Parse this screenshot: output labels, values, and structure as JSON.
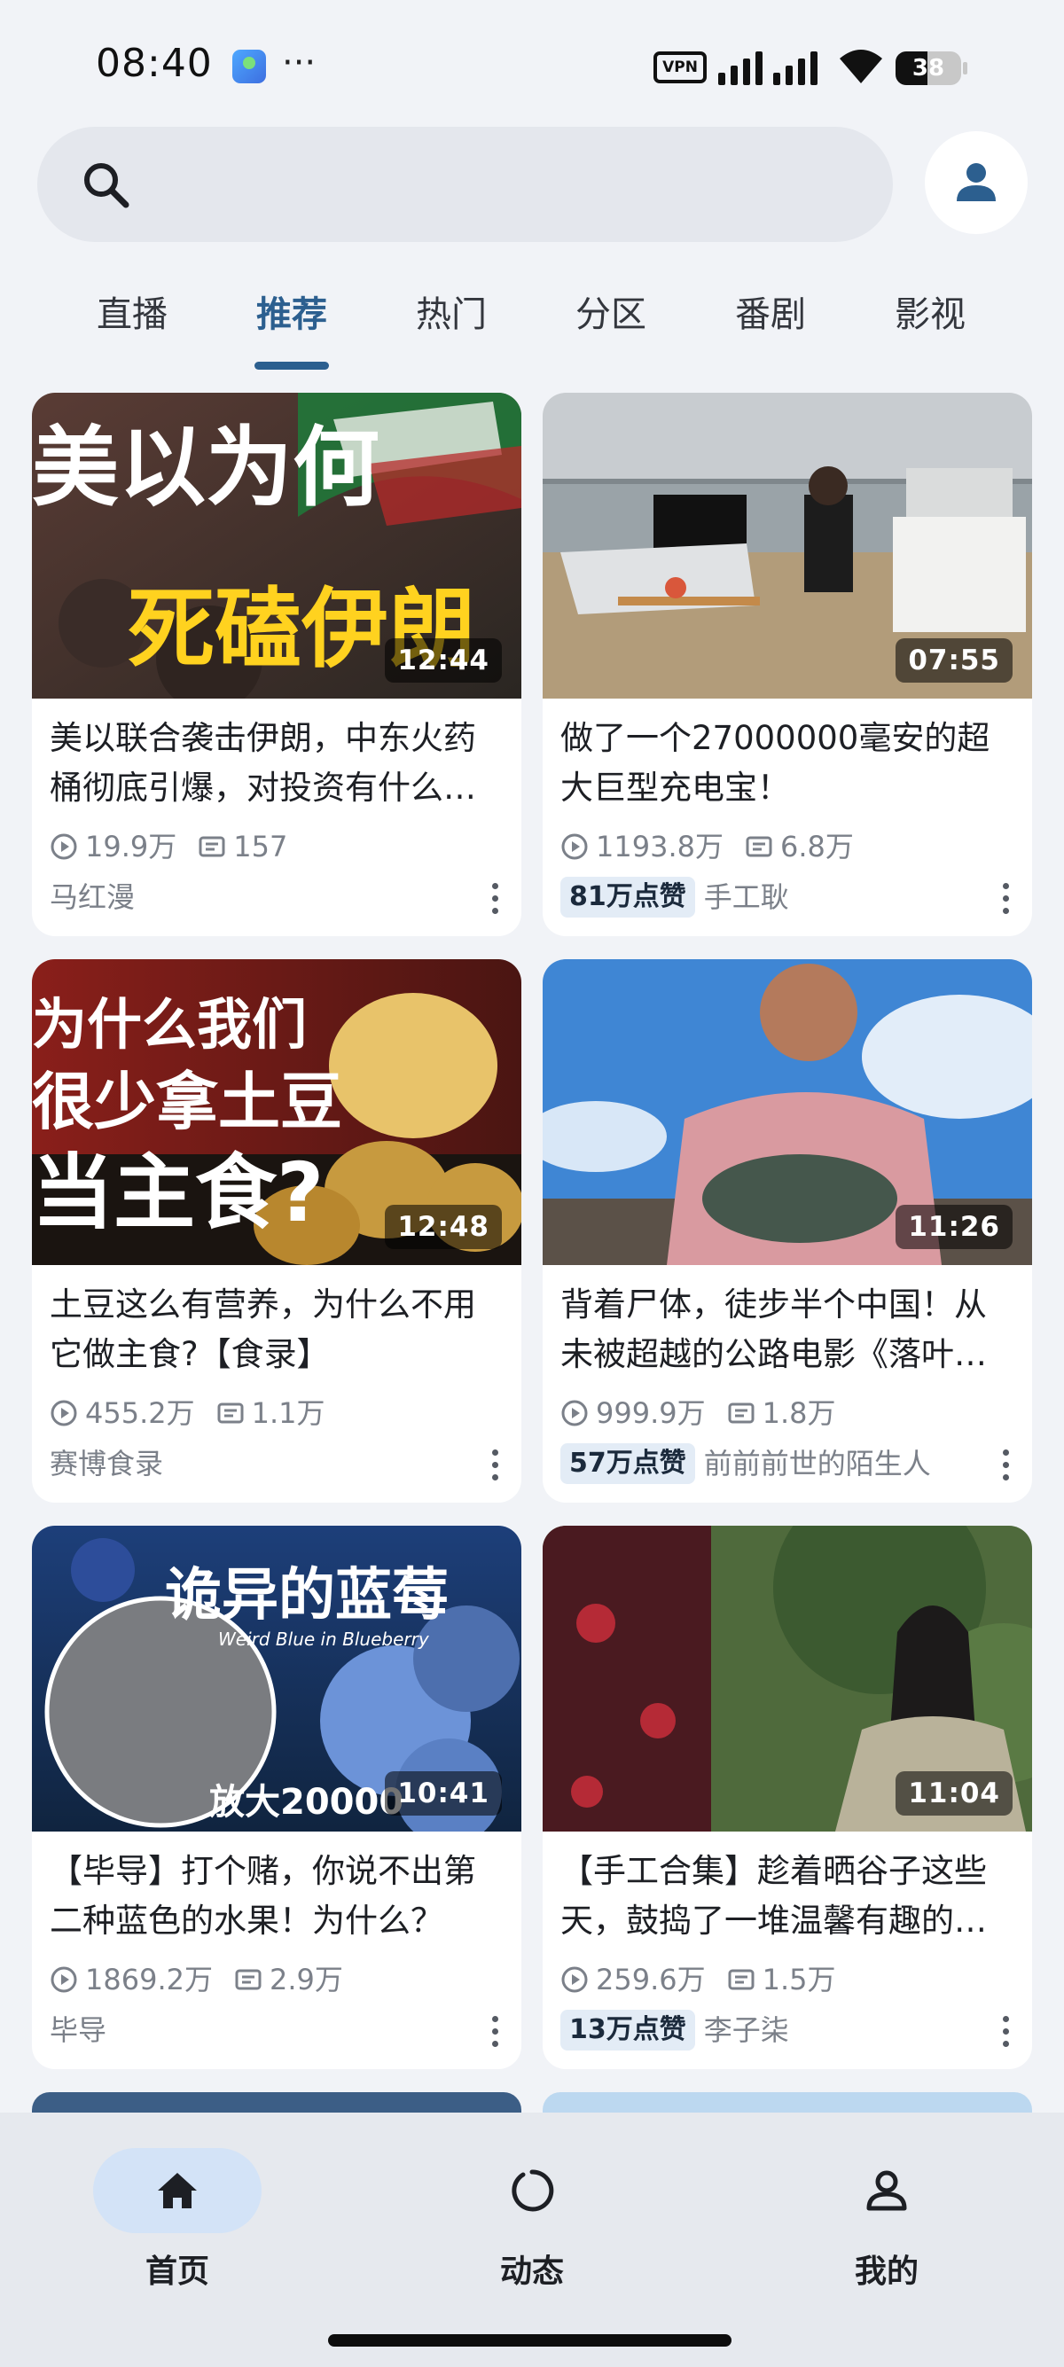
{
  "status_bar": {
    "time": "08:40",
    "dots": "···",
    "vpn": "VPN",
    "battery": "38"
  },
  "search": {
    "placeholder": ""
  },
  "tabs": [
    {
      "label": "直播",
      "active": false
    },
    {
      "label": "推荐",
      "active": true
    },
    {
      "label": "热门",
      "active": false
    },
    {
      "label": "分区",
      "active": false
    },
    {
      "label": "番剧",
      "active": false
    },
    {
      "label": "影视",
      "active": false
    }
  ],
  "videos": [
    {
      "title": "美以联合袭击伊朗，中东火药桶彻底引爆，对投资有什么影响？",
      "duration": "12:44",
      "views": "19.9万",
      "danmaku": "157",
      "likes": "",
      "author": "马红漫",
      "thumb_text": [
        "美以为何",
        "死磕伊朗"
      ]
    },
    {
      "title": "做了一个27000000毫安的超大巨型充电宝！",
      "duration": "07:55",
      "views": "1193.8万",
      "danmaku": "6.8万",
      "likes": "81万点赞",
      "author": "手工耿",
      "thumb_text": []
    },
    {
      "title": "土豆这么有营养，为什么不用它做主食?【食录】",
      "duration": "12:48",
      "views": "455.2万",
      "danmaku": "1.1万",
      "likes": "",
      "author": "赛博食录",
      "thumb_text": [
        "为什么我们",
        "很少拿土豆",
        "当主食?"
      ]
    },
    {
      "title": "背着尸体，徒步半个中国！从未被超越的公路电影《落叶归根》",
      "duration": "11:26",
      "views": "999.9万",
      "danmaku": "1.8万",
      "likes": "57万点赞",
      "author": "前前前世的陌生人",
      "thumb_text": []
    },
    {
      "title": "【毕导】打个赌，你说不出第二种蓝色的水果！为什么？",
      "duration": "10:41",
      "views": "1869.2万",
      "danmaku": "2.9万",
      "likes": "",
      "author": "毕导",
      "thumb_text": [
        "诡异的蓝莓",
        "Weird Blue in Blueberry",
        "放大20000"
      ]
    },
    {
      "title": "【手工合集】趁着晒谷子这些天，鼓捣了一堆温馨有趣的小物件",
      "duration": "11:04",
      "views": "259.6万",
      "danmaku": "1.5万",
      "likes": "13万点赞",
      "author": "李子柒",
      "thumb_text": []
    }
  ],
  "bottom_nav": [
    {
      "label": "首页",
      "icon": "home-icon",
      "active": true
    },
    {
      "label": "动态",
      "icon": "activity-icon",
      "active": false
    },
    {
      "label": "我的",
      "icon": "profile-icon",
      "active": false
    }
  ],
  "colors": {
    "accent": "#2c5f8f",
    "background": "#f1f3f7",
    "likes_bg": "#e3ecf6"
  }
}
